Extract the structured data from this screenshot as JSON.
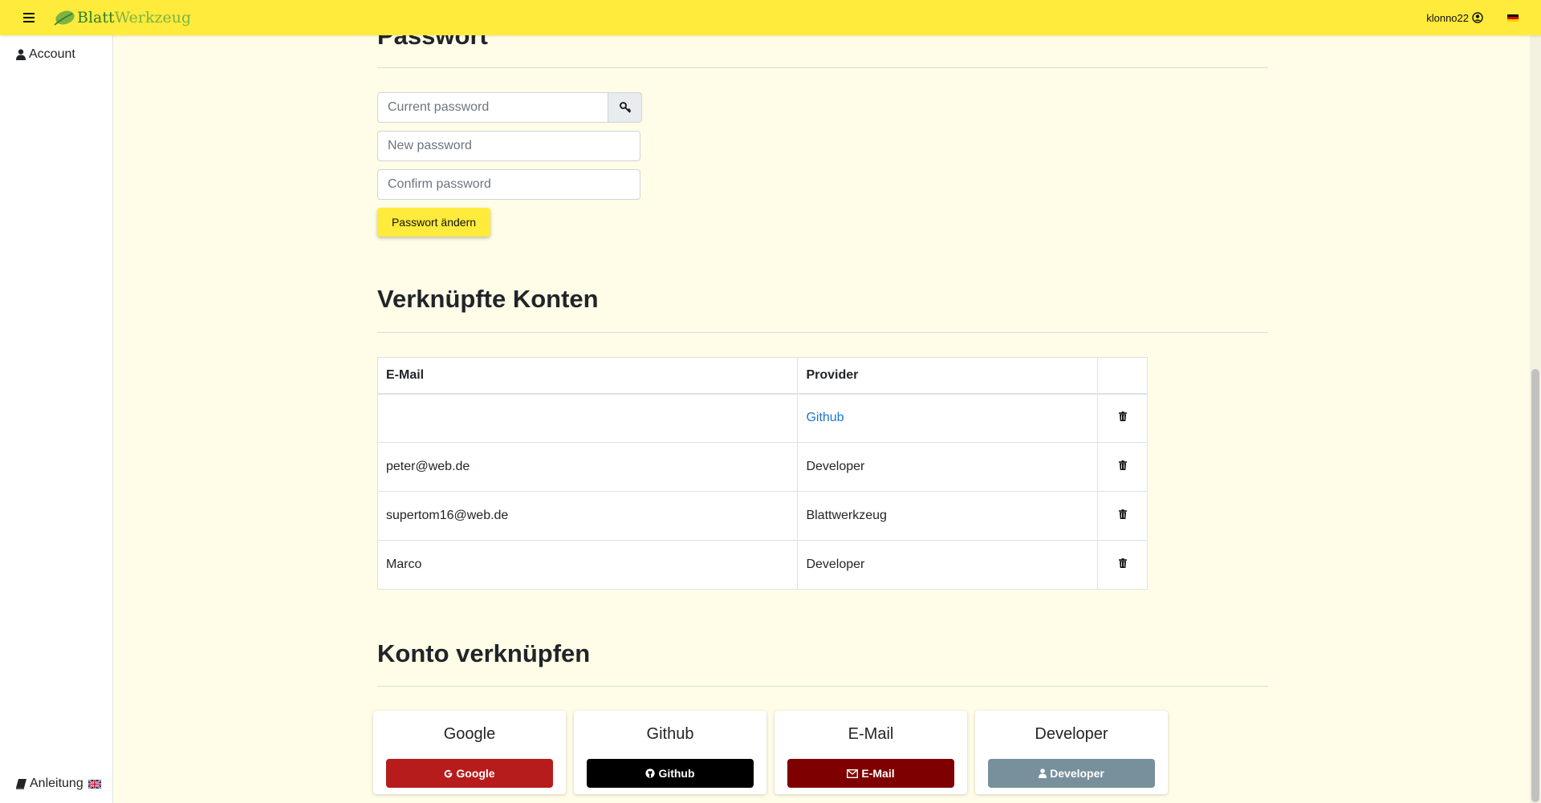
{
  "header": {
    "brand_part1": "Blatt",
    "brand_part2": "Werkzeug",
    "username": "klonno22",
    "menu_icon": "hamburger-icon",
    "user_icon": "user-circle-icon",
    "language_flag": "flag-de-icon"
  },
  "sidebar": {
    "account_label": "Account",
    "account_icon": "user-icon",
    "manual_label": "Anleitung",
    "manual_icon": "book-icon",
    "manual_flag": "flag-uk-icon"
  },
  "password_section": {
    "title": "Passwort",
    "current_placeholder": "Current password",
    "new_placeholder": "New password",
    "confirm_placeholder": "Confirm password",
    "submit_label": "Passwort ändern",
    "key_icon": "key-icon"
  },
  "linked_accounts": {
    "title": "Verknüpfte Konten",
    "columns": [
      "E-Mail",
      "Provider",
      ""
    ],
    "rows": [
      {
        "email": "",
        "provider": "Github",
        "provider_is_link": true
      },
      {
        "email": "peter@web.de",
        "provider": "Developer",
        "provider_is_link": false
      },
      {
        "email": "supertom16@web.de",
        "provider": "Blattwerkzeug",
        "provider_is_link": false
      },
      {
        "email": "Marco",
        "provider": "Developer",
        "provider_is_link": false
      }
    ],
    "delete_icon": "trash-icon"
  },
  "link_account": {
    "title": "Konto verknüpfen",
    "providers": [
      {
        "title": "Google",
        "button": "Google",
        "color": "#b71c1c",
        "icon": "google-icon"
      },
      {
        "title": "Github",
        "button": "Github",
        "color": "#000000",
        "icon": "github-icon"
      },
      {
        "title": "E-Mail",
        "button": "E-Mail",
        "color": "#7f0000",
        "icon": "envelope-icon"
      },
      {
        "title": "Developer",
        "button": "Developer",
        "color": "#78909c",
        "icon": "user-icon"
      }
    ]
  },
  "colors": {
    "topbar": "#ffeb3b",
    "background": "#fffde7",
    "link": "#1976d2"
  }
}
